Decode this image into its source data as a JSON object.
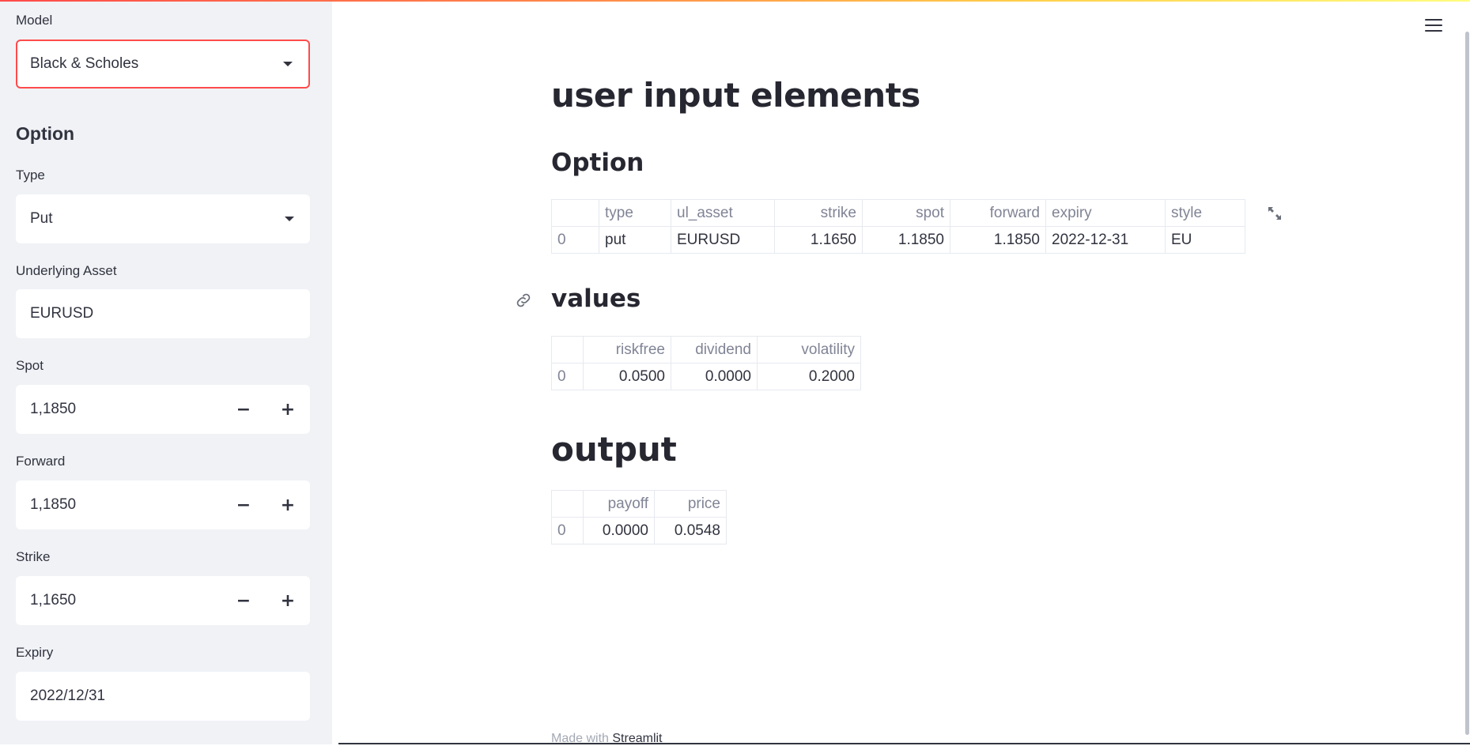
{
  "sidebar": {
    "model": {
      "label": "Model",
      "value": "Black & Scholes"
    },
    "section_title": "Option",
    "type": {
      "label": "Type",
      "value": "Put"
    },
    "underlying": {
      "label": "Underlying Asset",
      "value": "EURUSD"
    },
    "spot": {
      "label": "Spot",
      "value": "1,1850",
      "minus": "−",
      "plus": "+"
    },
    "forward": {
      "label": "Forward",
      "value": "1,1850",
      "minus": "−",
      "plus": "+"
    },
    "strike": {
      "label": "Strike",
      "value": "1,1650",
      "minus": "−",
      "plus": "+"
    },
    "expiry": {
      "label": "Expiry",
      "value": "2022/12/31"
    }
  },
  "main": {
    "title": "user input elements",
    "option_heading": "Option",
    "option_table": {
      "columns": [
        "",
        "type",
        "ul_asset",
        "strike",
        "spot",
        "forward",
        "expiry",
        "style"
      ],
      "rows": [
        [
          "0",
          "put",
          "EURUSD",
          "1.1650",
          "1.1850",
          "1.1850",
          "2022-12-31",
          "EU"
        ]
      ]
    },
    "values_heading": "values",
    "values_table": {
      "columns": [
        "",
        "riskfree",
        "dividend",
        "volatility"
      ],
      "rows": [
        [
          "0",
          "0.0500",
          "0.0000",
          "0.2000"
        ]
      ]
    },
    "output_heading": "output",
    "output_table": {
      "columns": [
        "",
        "payoff",
        "price"
      ],
      "rows": [
        [
          "0",
          "0.0000",
          "0.0548"
        ]
      ]
    },
    "footer_prefix": "Made with",
    "footer_brand": "Streamlit"
  },
  "colors": {
    "accent": "#ff4b4b",
    "sidebar_bg": "#f0f2f6",
    "text": "#31333f",
    "muted": "#808495"
  },
  "icons": [
    "menu-icon",
    "link-icon",
    "expand-icon",
    "chevron-down-icon"
  ]
}
